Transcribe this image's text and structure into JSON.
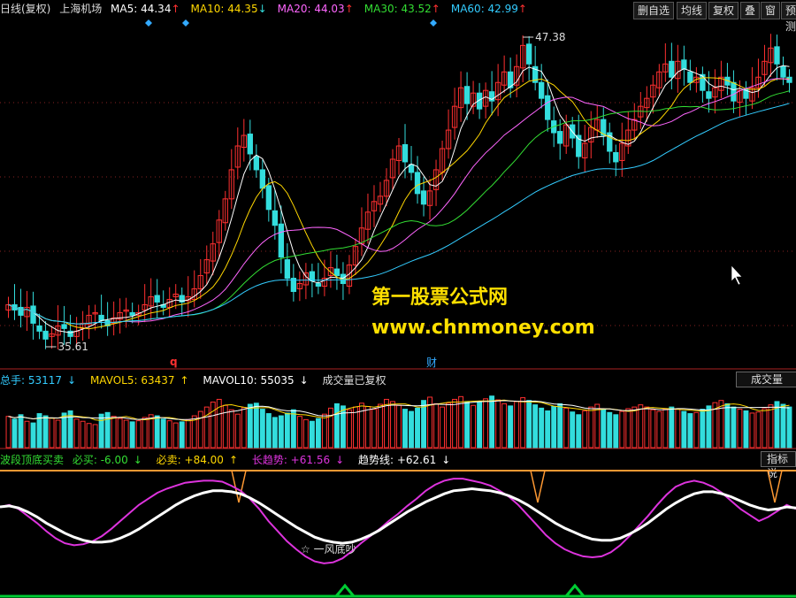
{
  "header": {
    "period": "日线(复权)",
    "stock": "上海机场",
    "ma": [
      {
        "label": "MA5: 44.34",
        "arrow": "↑",
        "color": "#ffffff"
      },
      {
        "label": "MA10: 44.35",
        "arrow": "↓",
        "color": "#ffd700"
      },
      {
        "label": "MA20: 44.03",
        "arrow": "↑",
        "color": "#ff66ff"
      },
      {
        "label": "MA30: 43.52",
        "arrow": "↑",
        "color": "#33dd33"
      },
      {
        "label": "MA60: 42.99",
        "arrow": "↑",
        "color": "#33ccff"
      }
    ],
    "toolbar": [
      "删自选",
      "均线",
      "复权",
      "叠",
      "窗",
      "预测"
    ]
  },
  "price_pane": {
    "high_label": "47.38",
    "low_label": "35.61",
    "marker_q": "q",
    "marker_cai": "财",
    "watermark_line1": "第一股票公式网",
    "watermark_line2": "www.chnmoney.com"
  },
  "volume_pane": {
    "total": "总手: 53117",
    "total_arrow": "↓",
    "mavol5": "MAVOL5: 63437",
    "mavol5_arrow": "↑",
    "mavol10": "MAVOL10: 55035",
    "mavol10_arrow": "↓",
    "note": "成交量已复权",
    "button": "成交量"
  },
  "indicator_pane": {
    "name": "波段顶底买卖",
    "buy": "必买: -6.00",
    "buy_arrow": "↓",
    "sell": "必卖: +84.00",
    "sell_arrow": "↑",
    "long_trend": "长趋势: +61.56",
    "long_trend_arrow": "↓",
    "trend": "趋势线: +62.61",
    "trend_arrow": "↓",
    "button": "指标说",
    "bottom_note": "☆ 一风底吵"
  },
  "colors": {
    "up": "#ff3030",
    "down": "#33dddd",
    "ma5": "#ffffff",
    "ma10": "#ffd700",
    "ma20": "#ff66ff",
    "ma30": "#33dd33",
    "ma60": "#33ccff",
    "purple": "#dd33dd",
    "orange": "#ff9933",
    "green": "#00cc33"
  },
  "chart_data": [
    {
      "type": "candlestick",
      "title": "上海机场",
      "ylim": [
        35.61,
        47.38
      ],
      "y_marks": [
        {
          "label": "47.38",
          "value": 47.38
        },
        {
          "label": "35.61",
          "value": 35.61
        }
      ],
      "closes": [
        37.2,
        37.0,
        36.8,
        37.1,
        36.5,
        36.2,
        35.9,
        36.1,
        36.4,
        36.3,
        36.0,
        36.2,
        36.5,
        36.8,
        36.9,
        36.6,
        36.4,
        36.7,
        36.9,
        37.0,
        36.8,
        36.9,
        37.2,
        37.5,
        37.3,
        37.1,
        37.4,
        37.6,
        37.3,
        37.5,
        37.8,
        38.3,
        38.9,
        39.5,
        40.4,
        41.2,
        42.3,
        43.2,
        43.6,
        42.9,
        42.3,
        41.6,
        40.8,
        40.2,
        39.0,
        38.2,
        37.7,
        38.0,
        38.4,
        38.1,
        37.9,
        38.2,
        38.6,
        38.3,
        38.0,
        38.7,
        39.4,
        40.1,
        40.7,
        41.1,
        41.3,
        41.9,
        42.7,
        43.2,
        42.6,
        42.2,
        41.4,
        41.0,
        41.5,
        42.3,
        43.1,
        43.8,
        44.7,
        45.4,
        44.8,
        45.2,
        44.6,
        45.3,
        44.9,
        45.6,
        46.0,
        45.4,
        46.2,
        47.0,
        46.3,
        45.6,
        45.0,
        44.2,
        43.7,
        43.3,
        44.0,
        43.5,
        42.8,
        43.3,
        43.9,
        44.2,
        43.6,
        43.0,
        42.6,
        43.3,
        43.8,
        44.2,
        44.7,
        45.0,
        45.5,
        46.0,
        46.3,
        45.8,
        46.4,
        46.1,
        45.6,
        45.8,
        45.3,
        45.0,
        45.4,
        45.8,
        45.5,
        44.9,
        45.3,
        45.0,
        45.4,
        45.8,
        46.4,
        46.9,
        46.3,
        45.8,
        45.6
      ]
    },
    {
      "type": "bar",
      "title": "成交量",
      "values": [
        57,
        52,
        60,
        48,
        45,
        62,
        58,
        54,
        50,
        63,
        67,
        52,
        48,
        44,
        42,
        61,
        64,
        57,
        53,
        50,
        47,
        49,
        55,
        60,
        58,
        52,
        49,
        45,
        47,
        51,
        58,
        66,
        74,
        83,
        88,
        77,
        69,
        61,
        73,
        79,
        81,
        70,
        62,
        55,
        58,
        63,
        69,
        57,
        51,
        48,
        53,
        61,
        72,
        80,
        76,
        69,
        74,
        81,
        75,
        70,
        79,
        88,
        84,
        77,
        70,
        66,
        72,
        86,
        92,
        80,
        74,
        81,
        88,
        93,
        84,
        77,
        83,
        89,
        94,
        87,
        80,
        76,
        84,
        91,
        86,
        78,
        72,
        67,
        75,
        80,
        72,
        65,
        60,
        67,
        74,
        79,
        70,
        64,
        60,
        66,
        71,
        74,
        78,
        74,
        69,
        66,
        70,
        74,
        70,
        66,
        62,
        64,
        70,
        76,
        82,
        86,
        80,
        74,
        70,
        67,
        63,
        65,
        71,
        78,
        84,
        79,
        74
      ]
    },
    {
      "type": "line",
      "title": "波段顶底买卖",
      "series": [
        {
          "name": "长趋势",
          "values": [
            64,
            66,
            62,
            55,
            48,
            40,
            33,
            28,
            26,
            27,
            30,
            35,
            42,
            50,
            58,
            66,
            72,
            78,
            82,
            85,
            88,
            89,
            90,
            90,
            89,
            85,
            80,
            72,
            62,
            50,
            40,
            30,
            22,
            15,
            10,
            8,
            9,
            13,
            20,
            28,
            35,
            42,
            50,
            57,
            65,
            72,
            80,
            86,
            90,
            92,
            92,
            90,
            88,
            85,
            80,
            74,
            66,
            56,
            46,
            36,
            28,
            22,
            18,
            15,
            14,
            15,
            19,
            26,
            35,
            45,
            55,
            66,
            76,
            84,
            88,
            90,
            88,
            84,
            78,
            70,
            62,
            56,
            50,
            54,
            60,
            66,
            62
          ]
        },
        {
          "name": "趋势线",
          "values": [
            64,
            65,
            63,
            59,
            54,
            48,
            43,
            38,
            34,
            31,
            29,
            29,
            30,
            33,
            37,
            42,
            48,
            54,
            60,
            66,
            71,
            75,
            78,
            80,
            80,
            79,
            77,
            73,
            68,
            62,
            56,
            50,
            44,
            39,
            34,
            31,
            29,
            28,
            29,
            32,
            36,
            41,
            47,
            53,
            59,
            64,
            69,
            73,
            77,
            80,
            81,
            82,
            81,
            80,
            78,
            75,
            71,
            66,
            60,
            54,
            48,
            43,
            39,
            35,
            32,
            31,
            31,
            33,
            37,
            42,
            48,
            55,
            62,
            68,
            73,
            77,
            79,
            79,
            77,
            74,
            70,
            66,
            63,
            61,
            62,
            64,
            63
          ]
        }
      ]
    }
  ]
}
